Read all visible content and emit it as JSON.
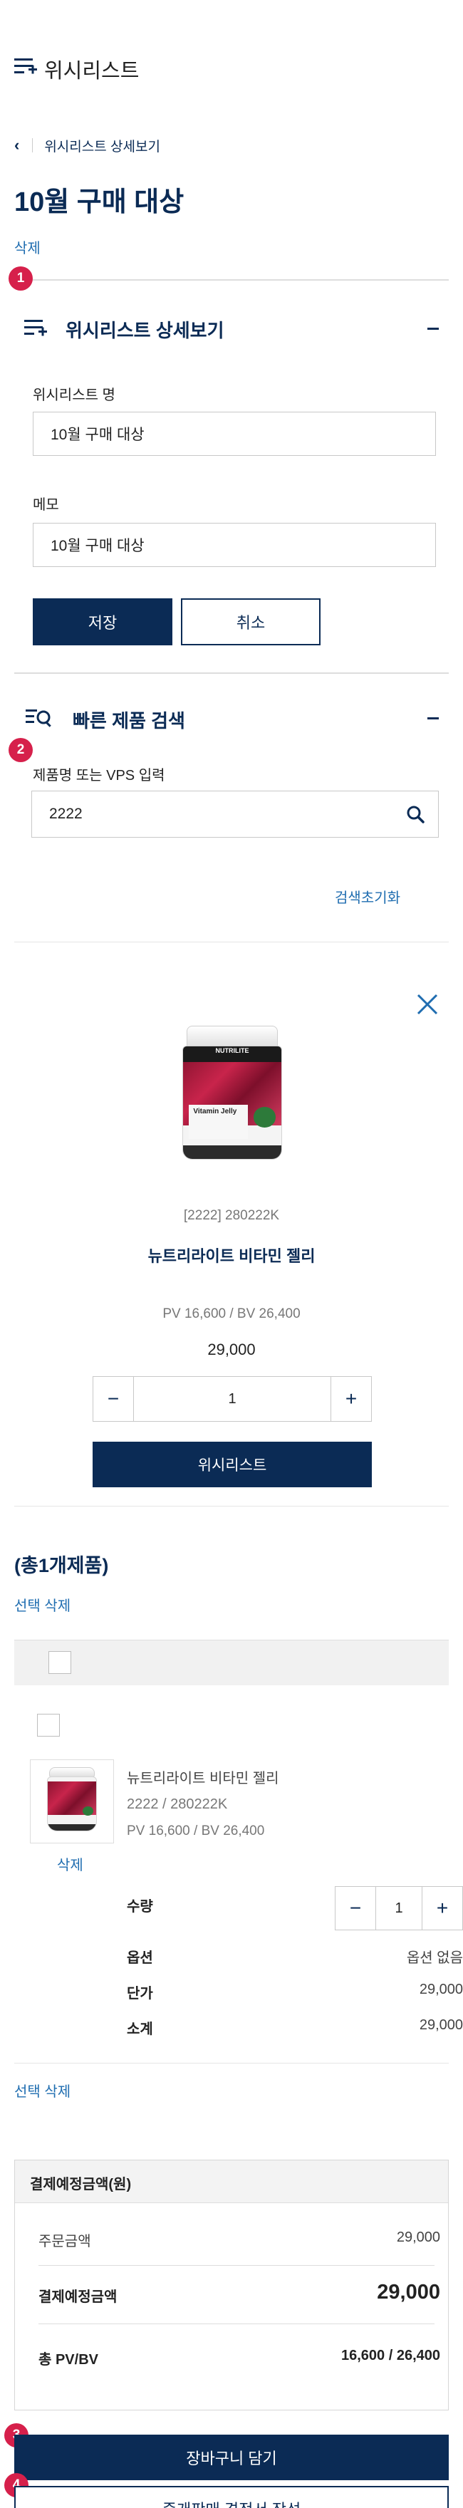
{
  "header": {
    "title": "위시리스트"
  },
  "breadcrumb": {
    "label": "위시리스트 상세보기"
  },
  "page": {
    "title": "10월 구매 대상",
    "delete_link": "삭제"
  },
  "badges": [
    "1",
    "2",
    "3",
    "4"
  ],
  "detail_section": {
    "title": "위시리스트 상세보기",
    "name_label": "위시리스트 명",
    "name_value": "10월 구매 대상",
    "memo_label": "메모",
    "memo_value": "10월 구매 대상",
    "save_label": "저장",
    "cancel_label": "취소"
  },
  "search_section": {
    "title": "빠른 제품 검색",
    "input_label": "제품명 또는 VPS 입력",
    "input_value": "2222",
    "reset_link": "검색초기화"
  },
  "search_result": {
    "image_brand": "NUTRILITE",
    "image_name": "Vitamin Jelly",
    "code": "[2222] 280222K",
    "name": "뉴트리라이트 비타민 젤리",
    "pvbv": "PV 16,600 / BV 26,400",
    "price": "29,000",
    "qty": "1",
    "add_label": "위시리스트"
  },
  "list_section": {
    "count_label": "(총1개제품)",
    "select_delete": "선택 삭제",
    "item": {
      "name": "뉴트리라이트 비타민 젤리",
      "code": "2222 / 280222K",
      "pvbv": "PV 16,600 / BV 26,400",
      "delete_label": "삭제",
      "qty_label": "수량",
      "qty": "1",
      "option_label": "옵션",
      "option_value": "옵션 없음",
      "unit_price_label": "단가",
      "unit_price": "29,000",
      "subtotal_label": "소계",
      "subtotal": "29,000"
    },
    "select_delete_bottom": "선택 삭제"
  },
  "summary": {
    "title": "결제예정금액(원)",
    "order_amount_label": "주문금액",
    "order_amount": "29,000",
    "expected_label": "결제예정금액",
    "expected": "29,000",
    "pvbv_label": "총 PV/BV",
    "pvbv": "16,600 / 26,400"
  },
  "actions": {
    "cart_label": "장바구니 담기",
    "quote_label": "중개판매 견적서 작성"
  },
  "colors": {
    "navy": "#0b2b55",
    "link_blue": "#1f6db0",
    "badge_red": "#d6204b"
  }
}
